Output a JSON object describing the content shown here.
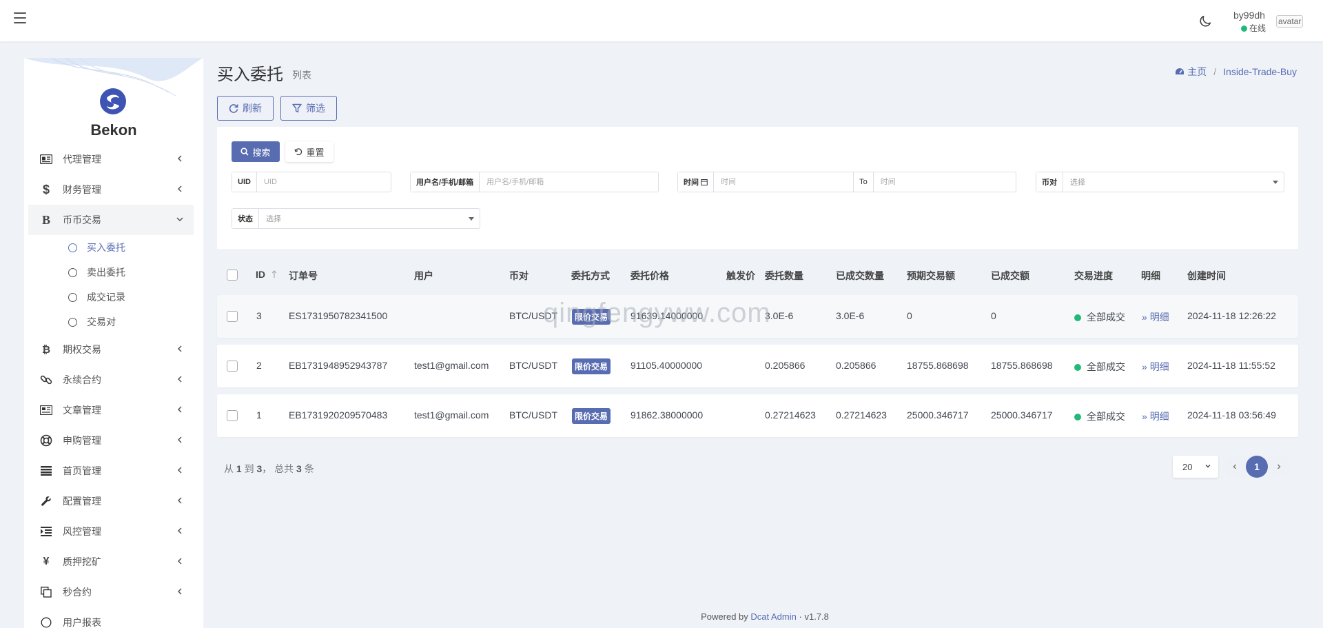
{
  "navbar": {
    "user_name": "by99dh",
    "user_status": "在线",
    "avatar_alt": "avatar"
  },
  "sidebar": {
    "brand": "Bekon",
    "items": [
      {
        "label": "代理管理",
        "icon": "id-card-icon"
      },
      {
        "label": "财务管理",
        "icon": "dollar-icon"
      },
      {
        "label": "币币交易",
        "icon": "bitcoin-b-icon",
        "expanded": true
      },
      {
        "label": "期权交易",
        "icon": "bitcoin-icon"
      },
      {
        "label": "永续合约",
        "icon": "link-icon"
      },
      {
        "label": "文章管理",
        "icon": "newspaper-icon"
      },
      {
        "label": "申购管理",
        "icon": "lifebuoy-icon"
      },
      {
        "label": "首页管理",
        "icon": "bars-icon"
      },
      {
        "label": "配置管理",
        "icon": "wrench-icon"
      },
      {
        "label": "风控管理",
        "icon": "indent-icon"
      },
      {
        "label": "质押挖矿",
        "icon": "yen-icon"
      },
      {
        "label": "秒合约",
        "icon": "copy-icon"
      },
      {
        "label": "用户报表",
        "icon": "circle-icon"
      }
    ],
    "submenu": [
      {
        "label": "买入委托",
        "current": true
      },
      {
        "label": "卖出委托"
      },
      {
        "label": "成交记录"
      },
      {
        "label": "交易对"
      }
    ]
  },
  "header": {
    "title": "买入委托",
    "subtitle": "列表",
    "breadcrumb_home": "主页",
    "breadcrumb_current": "Inside-Trade-Buy"
  },
  "toolbar": {
    "refresh_label": "刷新",
    "filter_label": "筛选"
  },
  "filter": {
    "search_label": "搜索",
    "reset_label": "重置",
    "uid_label": "UID",
    "uid_placeholder": "UID",
    "user_label": "用户名/手机/邮箱",
    "user_placeholder": "用户名/手机/邮箱",
    "time_label": "时间",
    "time_placeholder": "时间",
    "to_label": "To",
    "to_placeholder": "时间",
    "pair_label": "币对",
    "pair_value": "选择",
    "status_label": "状态",
    "status_value": "选择"
  },
  "table": {
    "columns": [
      "ID",
      "订单号",
      "用户",
      "币对",
      "委托方式",
      "委托价格",
      "触发价",
      "委托数量",
      "已成交数量",
      "预期交易额",
      "已成交额",
      "交易进度",
      "明细",
      "创建时间"
    ],
    "rows": [
      {
        "id": "3",
        "order_no": "ES1731950782341500",
        "user": "",
        "pair": "BTC/USDT",
        "method": "限价交易",
        "price": "91639.14000000",
        "trigger": "",
        "qty": "3.0E-6",
        "filled_qty": "3.0E-6",
        "expected": "0",
        "filled_amount": "0",
        "progress": "全部成交",
        "detail": "明细",
        "created": "2024-11-18 12:26:22"
      },
      {
        "id": "2",
        "order_no": "EB1731948952943787",
        "user": "test1@gmail.com",
        "pair": "BTC/USDT",
        "method": "限价交易",
        "price": "91105.40000000",
        "trigger": "",
        "qty": "0.205866",
        "filled_qty": "0.205866",
        "expected": "18755.868698",
        "filled_amount": "18755.868698",
        "progress": "全部成交",
        "detail": "明细",
        "created": "2024-11-18 11:55:52"
      },
      {
        "id": "1",
        "order_no": "EB1731920209570483",
        "user": "test1@gmail.com",
        "pair": "BTC/USDT",
        "method": "限价交易",
        "price": "91862.38000000",
        "trigger": "",
        "qty": "0.27214623",
        "filled_qty": "0.27214623",
        "expected": "25000.346717",
        "filled_amount": "25000.346717",
        "progress": "全部成交",
        "detail": "明细",
        "created": "2024-11-18 03:56:49"
      }
    ]
  },
  "pagination": {
    "summary_prefix": "从",
    "from": "1",
    "summary_to": "到",
    "to": "3",
    "summary_total": "， 总共",
    "total": "3",
    "summary_suffix": "条",
    "per_page": "20",
    "current_page": "1"
  },
  "watermark": "qingfengyww.com",
  "footer": {
    "powered_by": "Powered by",
    "link": "Dcat Admin",
    "sep": "·",
    "version": "v1.7.8"
  },
  "colors": {
    "primary": "#586cb1",
    "success": "#21b978",
    "background": "#eff3f8"
  }
}
